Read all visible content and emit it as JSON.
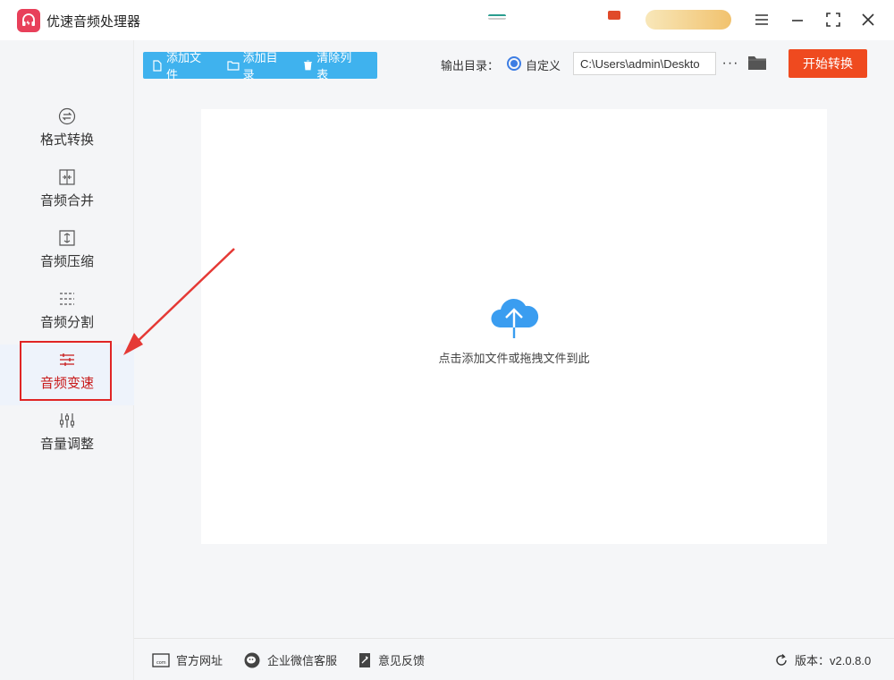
{
  "app": {
    "title": "优速音频处理器"
  },
  "sidebar": {
    "items": [
      {
        "label": "格式转换",
        "icon": "format-convert-icon"
      },
      {
        "label": "音频合并",
        "icon": "merge-icon"
      },
      {
        "label": "音频压缩",
        "icon": "compress-icon"
      },
      {
        "label": "音频分割",
        "icon": "split-icon"
      },
      {
        "label": "音频变速",
        "icon": "speed-icon",
        "active": true
      },
      {
        "label": "音量调整",
        "icon": "volume-sliders-icon"
      }
    ]
  },
  "toolbar": {
    "add_file": "添加文件",
    "add_dir": "添加目录",
    "clear_list": "清除列表"
  },
  "output": {
    "label": "输出目录：",
    "radio_label": "自定义",
    "path": "C:\\Users\\admin\\Deskto"
  },
  "start_button": "开始转换",
  "dropzone": {
    "hint": "点击添加文件或拖拽文件到此"
  },
  "footer": {
    "website": "官方网址",
    "wechat": "企业微信客服",
    "feedback": "意见反馈",
    "version": "版本：v2.0.8.0"
  },
  "colors": {
    "toolbar": "#3fb2ee",
    "start": "#ef4a1f",
    "active_text": "#c81a1a",
    "highlight": "#e02525",
    "cloud": "#3a9df0"
  }
}
